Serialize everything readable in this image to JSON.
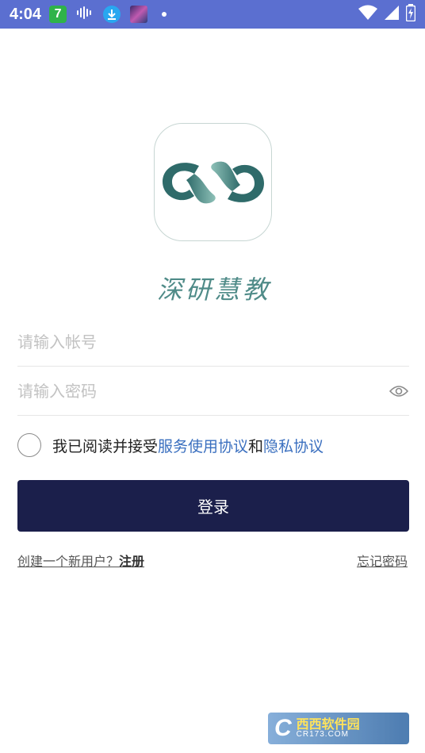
{
  "status_bar": {
    "time": "4:04",
    "badge": "7"
  },
  "brand": {
    "name": "深研慧教",
    "colors": {
      "teal_dark": "#2f6b6a",
      "teal_light": "#8ec1b8"
    }
  },
  "form": {
    "account_placeholder": "请输入帐号",
    "password_placeholder": "请输入密码",
    "account_value": "",
    "password_value": ""
  },
  "agreement": {
    "prefix": "我已阅读并接受 ",
    "service_link": "服务使用协议",
    "and": "和 ",
    "privacy_link": "隐私协议"
  },
  "login_label": "登录",
  "bottom": {
    "create_prefix": "创建一个新用户？",
    "register": "注册",
    "forgot": "忘记密码"
  },
  "watermark": {
    "main": "西西软件园",
    "sub": "CR173.COM"
  },
  "colors": {
    "status_bar": "#5b6fd0",
    "button": "#1b1f4b",
    "link": "#3a6fbf"
  }
}
